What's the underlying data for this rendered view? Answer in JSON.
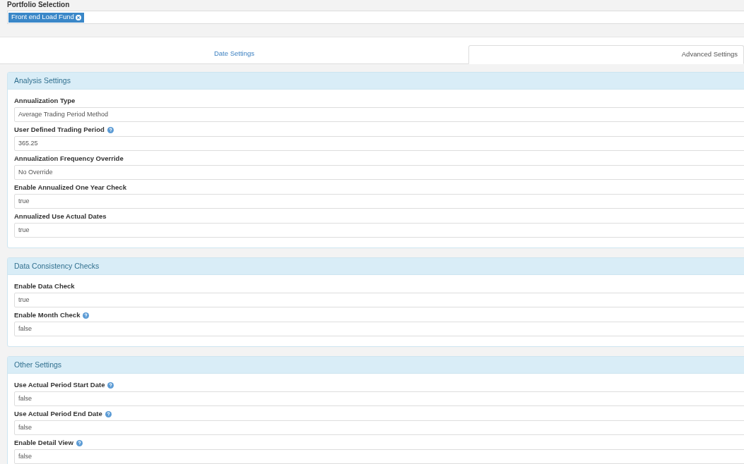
{
  "portfolio": {
    "label": "Portfolio Selection",
    "tags": [
      {
        "label": "Front end Load Fund"
      }
    ]
  },
  "tabs": [
    {
      "label": "Date Settings",
      "selected": false
    },
    {
      "label": "Advanced Settings",
      "selected": true
    }
  ],
  "panels": [
    {
      "title": "Analysis Settings",
      "fields": [
        {
          "label": "Annualization Type",
          "kind": "plain",
          "value": "Average Trading Period Method"
        },
        {
          "label": "User Defined Trading Period",
          "kind": "help",
          "value": "365.25"
        },
        {
          "label": "Annualization Frequency Override",
          "kind": "plain",
          "value": "No Override"
        },
        {
          "label": "Enable Annualized One Year Check",
          "kind": "plain",
          "value": "true"
        },
        {
          "label": "Annualized Use Actual Dates",
          "kind": "plain",
          "value": "true"
        }
      ]
    },
    {
      "title": "Data Consistency Checks",
      "fields": [
        {
          "label": "Enable Data Check",
          "kind": "plain",
          "value": "true"
        },
        {
          "label": "Enable Month Check",
          "kind": "help",
          "value": "false"
        }
      ]
    },
    {
      "title": "Other Settings",
      "fields": [
        {
          "label": "Use Actual Period Start Date",
          "kind": "help",
          "value": "false"
        },
        {
          "label": "Use Actual Period End Date",
          "kind": "help",
          "value": "false"
        },
        {
          "label": "Enable Detail View",
          "kind": "help",
          "value": "false"
        }
      ]
    }
  ]
}
